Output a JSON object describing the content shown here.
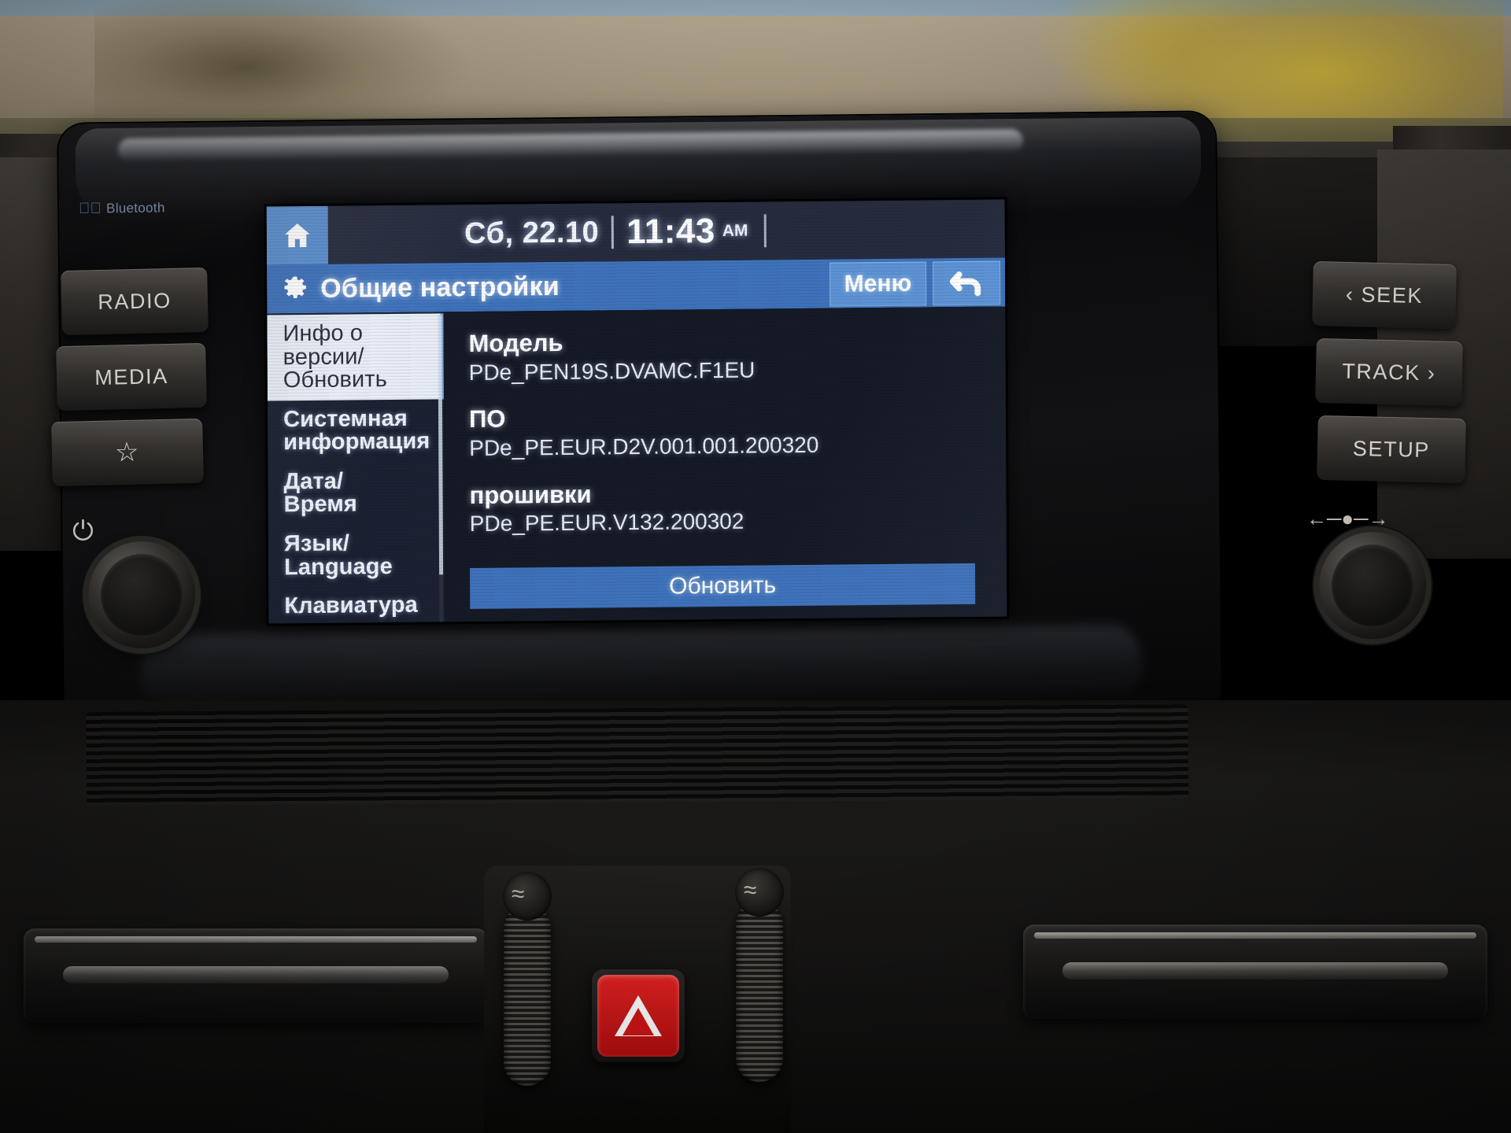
{
  "device": {
    "brand_badge": "Bluetooth",
    "hard_keys": {
      "radio": "RADIO",
      "media": "MEDIA",
      "favorite": "☆",
      "seek": "‹ SEEK",
      "track": "TRACK ›",
      "setup": "SETUP",
      "power_icon": "power-icon",
      "volume_icon": "volume-arc-icon"
    },
    "hazard_label": "hazard-warning-button"
  },
  "screen": {
    "statusbar": {
      "home_icon": "home-icon",
      "date": "Сб, 22.10",
      "time": "11:43",
      "meridiem": "AM"
    },
    "titlebar": {
      "icon": "gear-icon",
      "title": "Общие настройки",
      "menu_label": "Меню",
      "back_icon": "back-arrow-icon"
    },
    "sidebar": {
      "items": [
        {
          "id": "version-info-update",
          "line1": "Инфо о",
          "line2": "версии/",
          "line3": "Обновить",
          "active": true
        },
        {
          "id": "system-information",
          "line1": "Системная",
          "line2": "информация",
          "line3": "",
          "active": false
        },
        {
          "id": "date-time",
          "line1": "Дата/",
          "line2": "Время",
          "line3": "",
          "active": false
        },
        {
          "id": "language",
          "line1": "Язык/",
          "line2": "Language",
          "line3": "",
          "active": false
        },
        {
          "id": "keyboard",
          "line1": "Клавиатура",
          "line2": "",
          "line3": "",
          "active": false
        }
      ]
    },
    "content": {
      "fields": [
        {
          "id": "model",
          "label": "Модель",
          "value": "PDe_PEN19S.DVAMC.F1EU"
        },
        {
          "id": "software",
          "label": "ПО",
          "value": "PDe_PE.EUR.D2V.001.001.200320"
        },
        {
          "id": "firmware",
          "label": "прошивки",
          "value": "PDe_PE.EUR.V132.200302"
        }
      ],
      "update_button": "Обновить"
    }
  },
  "colors": {
    "accent_blue": "#3e72bb",
    "button_blue": "#5d93d4",
    "home_blue": "#5b8fce",
    "screen_bg": "#151a26",
    "statusbar_bg": "#262c3e",
    "sidebar_active_bg": "#e8eef7",
    "hazard_red": "#e32222"
  }
}
